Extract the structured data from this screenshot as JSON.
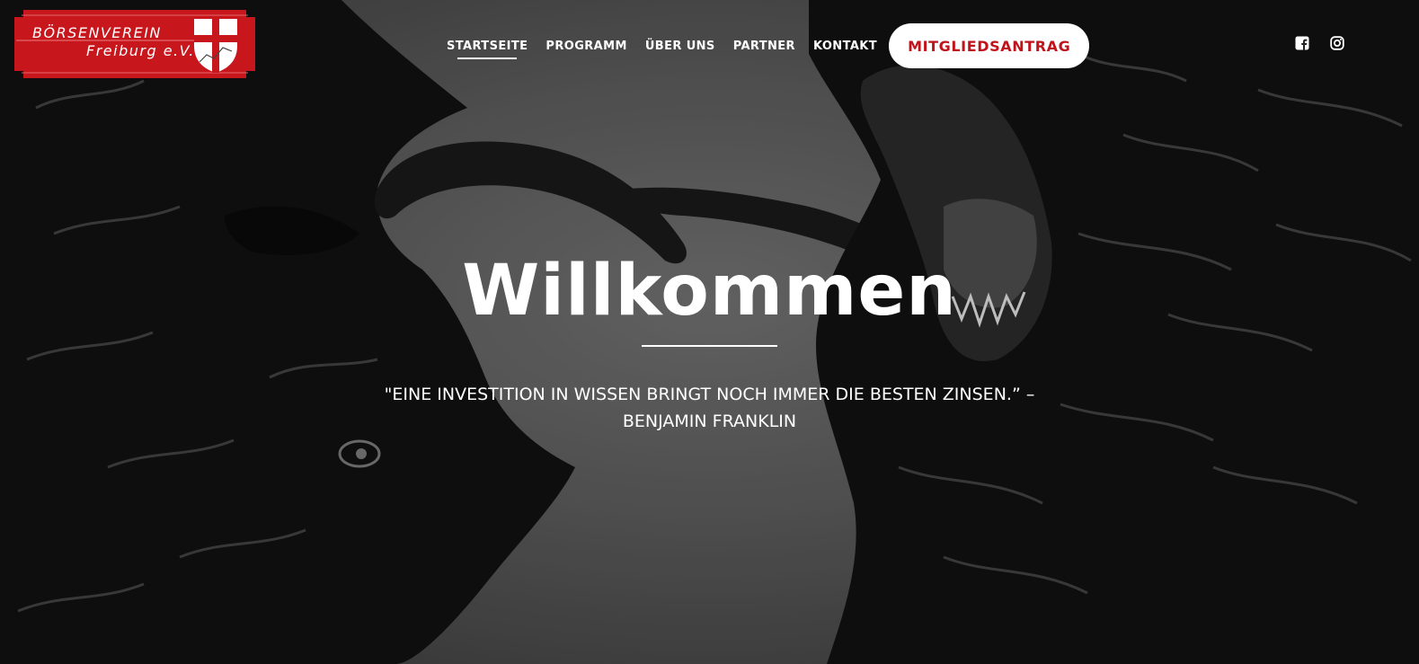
{
  "logo": {
    "line1": "BÖRSENVEREIN",
    "line2": "Freiburg e.V.",
    "color": "#c8161d"
  },
  "nav": {
    "items": [
      {
        "label": "STARTSEITE",
        "active": true
      },
      {
        "label": "PROGRAMM"
      },
      {
        "label": "ÜBER UNS"
      },
      {
        "label": "PARTNER"
      },
      {
        "label": "KONTAKT"
      }
    ],
    "cta_label": "MITGLIEDSANTRAG",
    "cta_color": "#c0141c"
  },
  "social": {
    "icons": [
      "facebook-icon",
      "instagram-icon"
    ]
  },
  "hero": {
    "title": "Willkommen",
    "quote_line1": "\"EINE INVESTITION IN WISSEN BRINGT NOCH IMMER DIE BESTEN ZINSEN.” –",
    "quote_line2": "BENJAMIN FRANKLIN"
  }
}
